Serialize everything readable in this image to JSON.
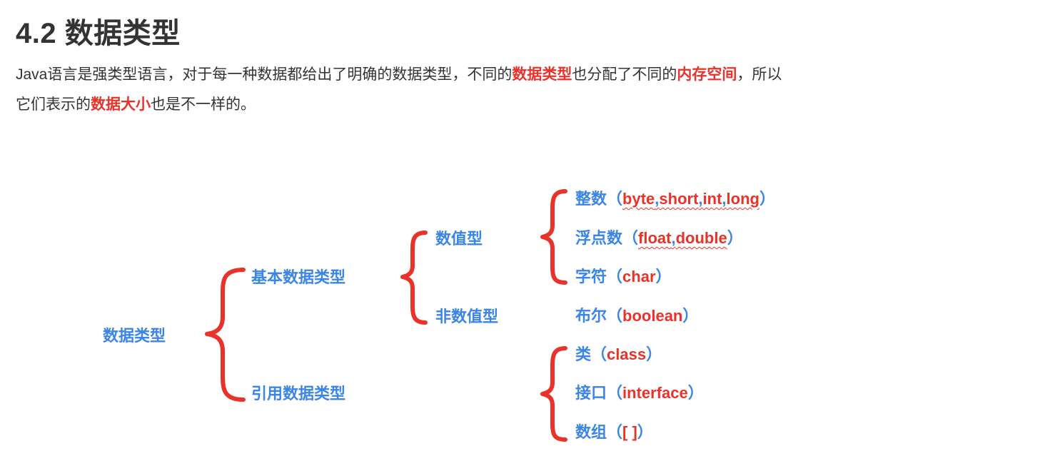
{
  "heading": "4.2 数据类型",
  "paragraph": {
    "part1": "Java语言是强类型语言，对于每一种数据都给出了明确的数据类型，不同的",
    "hl1": "数据类型",
    "part2": "也分配了不同的",
    "hl2": "内存空间",
    "part3": "，所以",
    "part4": "它们表示的",
    "hl3": "数据大小",
    "part5": "也是不一样的。"
  },
  "diagram": {
    "root": "数据类型",
    "primitive": "基本数据类型",
    "reference": "引用数据类型",
    "numeric": "数值型",
    "non_numeric": "非数值型",
    "integer": {
      "label": "整数",
      "open": "（",
      "t1": "byte",
      "sep1": ",",
      "t2": "short",
      "sep2": ",",
      "t3": "int",
      "sep3": ",",
      "t4": "long",
      "close": "）"
    },
    "float": {
      "label": "浮点数",
      "open": "（",
      "t1": "float",
      "sep1": ",",
      "t2": "double",
      "close": "）"
    },
    "char": {
      "label": "字符",
      "open": "（",
      "kw": "char",
      "close": "）"
    },
    "boolean": {
      "label": "布尔",
      "open": "（",
      "kw": "boolean",
      "close": "）"
    },
    "class": {
      "label": "类",
      "open": "（",
      "kw": "class",
      "close": "）"
    },
    "interface": {
      "label": "接口",
      "open": "（",
      "kw": "interface",
      "close": "）"
    },
    "array": {
      "label": "数组",
      "open": "（",
      "kw": "[ ]",
      "close": "）"
    }
  },
  "colors": {
    "text": "#333333",
    "highlight_red": "#e8322a",
    "node_blue": "#3a85e6",
    "brace_red": "#e8322a"
  }
}
